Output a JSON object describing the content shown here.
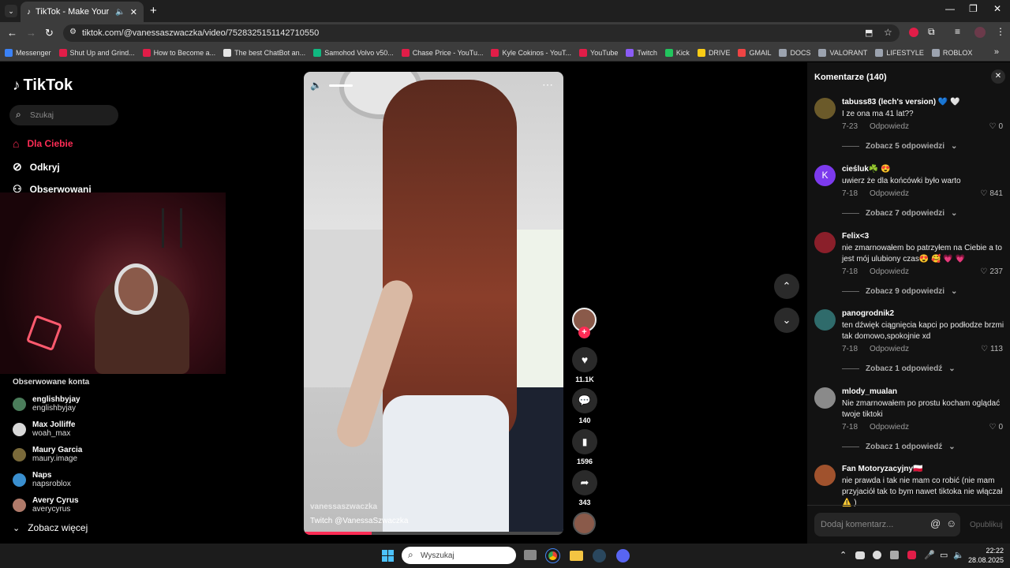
{
  "browser": {
    "tab_title": "TikTok - Make Your Day",
    "url": "tiktok.com/@vanessaszwaczka/video/7528325151142710550",
    "bookmarks": [
      {
        "label": "Messenger",
        "color": "#3b82f6"
      },
      {
        "label": "Shut Up and Grind...",
        "color": "#e11d48"
      },
      {
        "label": "How to Become a...",
        "color": "#e11d48"
      },
      {
        "label": "The best ChatBot an...",
        "color": "#e5e5e5"
      },
      {
        "label": "Samohod Volvo v50...",
        "color": "#10b981"
      },
      {
        "label": "Chase Price - YouTu...",
        "color": "#e11d48"
      },
      {
        "label": "Kyle Cokinos - YouT...",
        "color": "#e11d48"
      },
      {
        "label": "YouTube",
        "color": "#e11d48"
      },
      {
        "label": "Twitch",
        "color": "#8b5cf6"
      },
      {
        "label": "Kick",
        "color": "#22c55e"
      },
      {
        "label": "DRIVE",
        "color": "#facc15"
      },
      {
        "label": "GMAIL",
        "color": "#ef4444"
      },
      {
        "label": "DOCS",
        "color": "#9ca3af"
      },
      {
        "label": "VALORANT",
        "color": "#9ca3af"
      },
      {
        "label": "LIFESTYLE",
        "color": "#9ca3af"
      },
      {
        "label": "ROBLOX",
        "color": "#9ca3af"
      }
    ]
  },
  "sidebar": {
    "logo": "TikTok",
    "search_placeholder": "Szukaj",
    "nav": {
      "for_you": "Dla Ciebie",
      "explore": "Odkryj",
      "following": "Obserwowani"
    },
    "followed_heading": "Obserwowane konta",
    "accounts": [
      {
        "name": "englishbyjay",
        "user": "englishbyjay",
        "color": "#4b7d5b"
      },
      {
        "name": "Max Jolliffe",
        "user": "woah_max",
        "color": "#d8d8d8"
      },
      {
        "name": "Maury Garcia",
        "user": "maury.image",
        "color": "#7a6a3a"
      },
      {
        "name": "Naps",
        "user": "napsroblox",
        "color": "#3a8fcf"
      },
      {
        "name": "Avery Cyrus",
        "user": "averycyrus",
        "color": "#b07a6a"
      }
    ],
    "see_more": "Zobacz więcej"
  },
  "video": {
    "author": "vanessaszwaczka",
    "caption": "Twitch @VanessaSzwaczka",
    "likes": "11.1K",
    "comments": "140",
    "saves": "1596",
    "shares": "343",
    "progress": 0.26
  },
  "comments_panel": {
    "title": "Komentarze (140)",
    "reply_label": "Odpowiedz",
    "input_placeholder": "Dodaj komentarz...",
    "publish_label": "Opublikuj",
    "items": [
      {
        "name": "tabuss83 (lech's version) 💙 🤍",
        "text": "I ze ona ma 41 lat??",
        "date": "7-23",
        "likes": "0",
        "replies": "Zobacz 5 odpowiedzi",
        "color": "#6b5a2a"
      },
      {
        "name": "cieśluk☘️ 😍",
        "text": "uwierz że dla końcówki było warto",
        "date": "7-18",
        "likes": "841",
        "replies": "Zobacz 7 odpowiedzi",
        "color": "#7c3aed",
        "initial": "K"
      },
      {
        "name": "Felix<3",
        "text": "nie zmarnowałem bo patrzyłem na Ciebie a to jest mój ulubiony czas😍 🥰 💗 💗",
        "date": "7-18",
        "likes": "237",
        "replies": "Zobacz 9 odpowiedzi",
        "color": "#8a1f2a"
      },
      {
        "name": "panogrodnik2",
        "text": "ten dźwięk ciągnięcia kapci po podłodze brzmi tak domowo,spokojnie xd",
        "date": "7-18",
        "likes": "113",
        "replies": "Zobacz 1 odpowiedź",
        "color": "#2f6b6b"
      },
      {
        "name": "mlody_mualan",
        "text": "Nie zmarnowałem po prostu kocham oglądać twoje tiktoki",
        "date": "7-18",
        "likes": "0",
        "replies": "Zobacz 1 odpowiedź",
        "color": "#8a8a8a"
      },
      {
        "name": "Fan Motoryzacyjny🇵🇱",
        "text": "nie prawda i tak nie mam co robić (nie mam przyjaciół tak to bym nawet tiktoka nie włączał ⚠️ )",
        "date": "",
        "likes": "",
        "replies": "",
        "color": "#a0522d"
      }
    ]
  },
  "taskbar": {
    "search_placeholder": "Wyszukaj",
    "time": "22:22",
    "date": "28.08.2025"
  }
}
